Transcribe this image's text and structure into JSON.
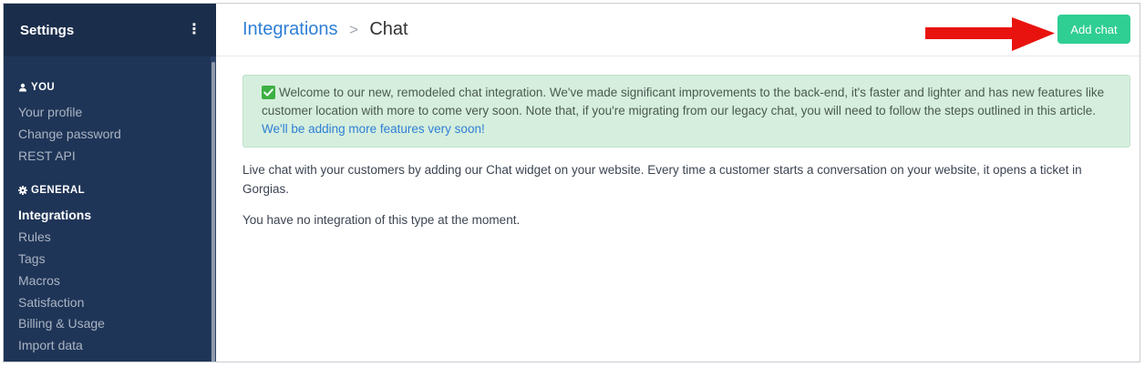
{
  "sidebar": {
    "title": "Settings",
    "menu_icon": "kebab-menu-icon",
    "sections": [
      {
        "heading": "YOU",
        "icon": "user-icon",
        "items": [
          {
            "label": "Your profile",
            "active": false
          },
          {
            "label": "Change password",
            "active": false
          },
          {
            "label": "REST API",
            "active": false
          }
        ]
      },
      {
        "heading": "GENERAL",
        "icon": "gear-icon",
        "items": [
          {
            "label": "Integrations",
            "active": true
          },
          {
            "label": "Rules",
            "active": false
          },
          {
            "label": "Tags",
            "active": false
          },
          {
            "label": "Macros",
            "active": false
          },
          {
            "label": "Satisfaction",
            "active": false
          },
          {
            "label": "Billing & Usage",
            "active": false
          },
          {
            "label": "Import data",
            "active": false
          }
        ]
      }
    ]
  },
  "header": {
    "breadcrumb_parent": "Integrations",
    "breadcrumb_separator": ">",
    "breadcrumb_current": "Chat",
    "add_button_label": "Add chat"
  },
  "alert": {
    "icon": "check-mark-icon",
    "text": "Welcome to our new, remodeled chat integration. We've made significant improvements to the back-end, it's faster and lighter and has new features like customer location with more to come very soon. Note that, if you're migrating from our legacy chat, you will need to follow the steps outlined in this article.",
    "link_text": "We'll be adding more features very soon!"
  },
  "main": {
    "description": "Live chat with your customers by adding our Chat widget on your website. Every time a customer starts a conversation on your website, it opens a ticket in Gorgias.",
    "empty_state": "You have no integration of this type at the moment."
  },
  "colors": {
    "sidebar_bg": "#1f3557",
    "accent_blue": "#2f7fd6",
    "button_green": "#2fce93",
    "alert_bg": "#d5eedd",
    "annotation_arrow": "#e8130f"
  }
}
